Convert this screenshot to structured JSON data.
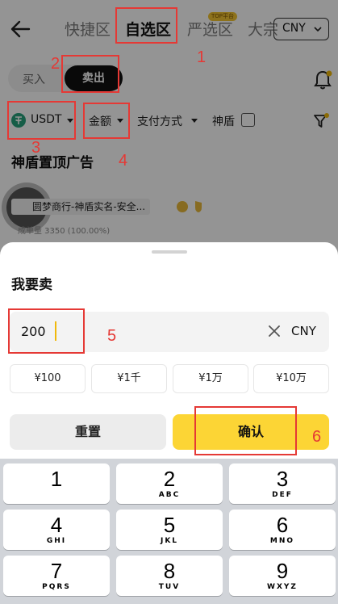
{
  "header": {
    "tabs": [
      "快捷区",
      "自选区",
      "严选区",
      "大宗"
    ],
    "active_tab": 1,
    "badge": "TOP平台",
    "currency": "CNY"
  },
  "trade_toggle": {
    "buy": "买入",
    "sell": "卖出",
    "active": "sell"
  },
  "filters": {
    "coin": "USDT",
    "amount": "金额",
    "payment": "支付方式",
    "shield": "神盾"
  },
  "ads": {
    "title": "神盾置顶广告",
    "merchant": "圆梦商行-神盾实名-安全...",
    "volume": "成单量 3350 (100.00%)"
  },
  "sheet": {
    "title": "我要卖",
    "amount_value": "200",
    "amount_currency": "CNY",
    "quick_amounts": [
      "¥100",
      "¥1千",
      "¥1万",
      "¥10万"
    ],
    "reset": "重置",
    "confirm": "确认"
  },
  "keypad": [
    {
      "num": "1",
      "letters": ""
    },
    {
      "num": "2",
      "letters": "ABC"
    },
    {
      "num": "3",
      "letters": "DEF"
    },
    {
      "num": "4",
      "letters": "GHI"
    },
    {
      "num": "5",
      "letters": "JKL"
    },
    {
      "num": "6",
      "letters": "MNO"
    },
    {
      "num": "7",
      "letters": "PQRS"
    },
    {
      "num": "8",
      "letters": "TUV"
    },
    {
      "num": "9",
      "letters": "WXYZ"
    }
  ],
  "annotations": [
    "1",
    "2",
    "3",
    "4",
    "5",
    "6"
  ],
  "colors": {
    "accent": "#fcd535",
    "annotation": "#e53935",
    "sell_active": "#111111"
  }
}
